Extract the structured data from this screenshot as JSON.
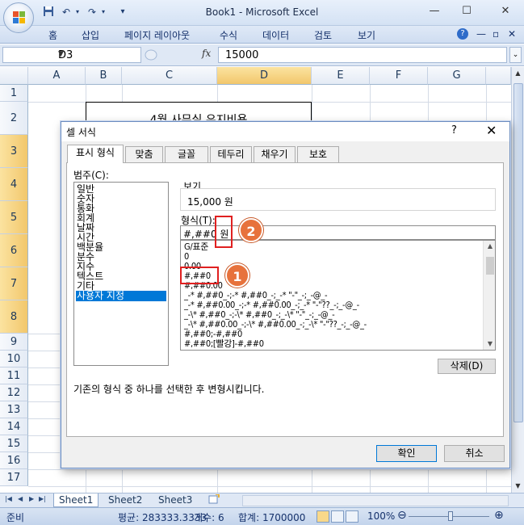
{
  "window": {
    "title": "Book1 - Microsoft Excel",
    "minimize": "—",
    "maximize": "☐",
    "close": "✕"
  },
  "qat": {
    "dropdown": "▾"
  },
  "ribbon": {
    "tabs": [
      "홈",
      "삽입",
      "페이지 레이아웃",
      "수식",
      "데이터",
      "검토",
      "보기"
    ],
    "help_icon": "?",
    "min_icon": "—",
    "restore_icon": "▫",
    "close_icon": "✕"
  },
  "formula_bar": {
    "name_box": "D3",
    "fx": "fx",
    "value": "15000"
  },
  "grid": {
    "columns": [
      "A",
      "B",
      "C",
      "D",
      "E",
      "F",
      "G"
    ],
    "selected_column": "D",
    "rows": [
      "1",
      "2",
      "3",
      "4",
      "5",
      "6",
      "7",
      "8",
      "9",
      "10",
      "11",
      "12",
      "13",
      "14",
      "15",
      "16",
      "17"
    ],
    "selected_rows": [
      "3",
      "4",
      "5",
      "6",
      "7",
      "8"
    ],
    "title_cell": "4월 사무실 유지비용"
  },
  "sheet_tabs": [
    "Sheet1",
    "Sheet2",
    "Sheet3"
  ],
  "status_bar": {
    "mode": "준비",
    "average": "평균: 283333.3333",
    "count": "개수: 6",
    "sum": "합계: 1700000",
    "zoom": "100%",
    "zoom_minus": "⊖",
    "zoom_plus": "⊕"
  },
  "dialog": {
    "title": "셀 서식",
    "help": "?",
    "close": "✕",
    "tabs": [
      "표시 형식",
      "맞춤",
      "글꼴",
      "테두리",
      "채우기",
      "보호"
    ],
    "active_tab": "표시 형식",
    "category_label": "범주(C):",
    "categories": [
      "일반",
      "숫자",
      "통화",
      "회계",
      "날짜",
      "시간",
      "백분율",
      "분수",
      "지수",
      "텍스트",
      "기타",
      "사용자 지정"
    ],
    "selected_category": "사용자 지정",
    "sample_label": "보기",
    "sample_value": "15,000 원",
    "type_label": "형식(T):",
    "type_value": "#,##0 원",
    "format_list": [
      "G/표준",
      "0",
      "0.00",
      "#,##0",
      "#,##0.00",
      "_-* #,##0_-;-* #,##0_-;_-* \"-\"_-;_-@_-",
      "_-* #,##0.00_-;-* #,##0.00_-;_-* \"-\"??_-;_-@_-",
      "_-\\* #,##0_-;-\\* #,##0_-;_-\\* \"-\"_-;_-@_-",
      "_-\\* #,##0.00_-;-\\* #,##0.00_-;_-\\* \"-\"??_-;_-@_-",
      "#,##0;-#,##0",
      "#,##0;[빨강]-#,##0"
    ],
    "delete_button": "삭제(D)",
    "description": "기존의 형식 중 하나를 선택한 후 변형시킵니다.",
    "ok_button": "확인",
    "cancel_button": "취소"
  },
  "annotations": {
    "badge1": "1",
    "badge2": "2",
    "color": "#e02020"
  }
}
